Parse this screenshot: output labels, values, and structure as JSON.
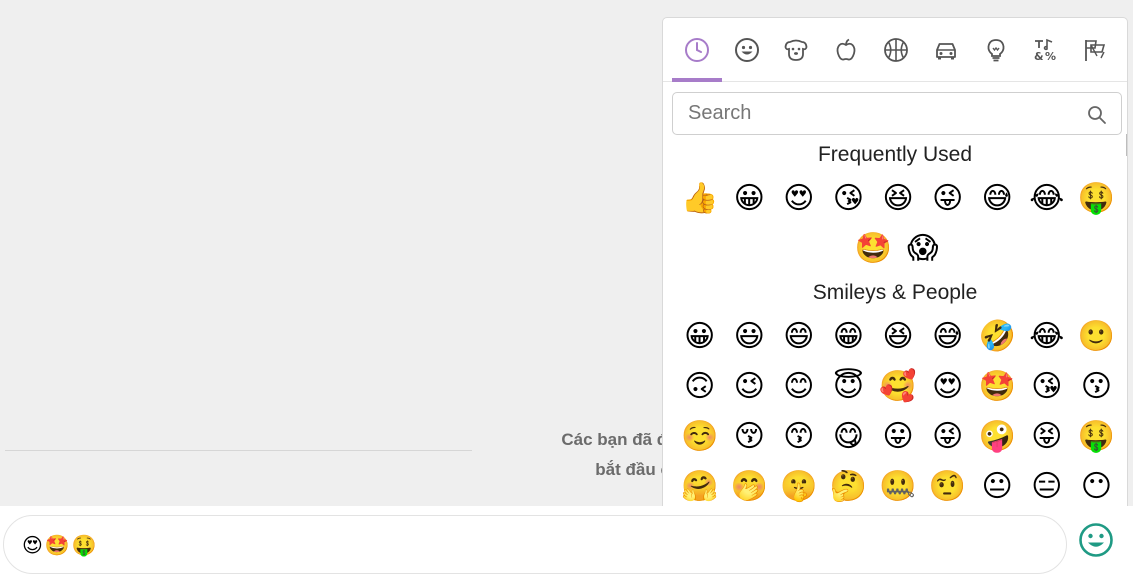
{
  "chat": {
    "system_message_line1": "Các bạn đã được kê",
    "system_message_line2": "bắt đầu cuộ"
  },
  "picker": {
    "tabs": [
      {
        "name": "tab-recent",
        "icon": "clock-icon"
      },
      {
        "name": "tab-smileys",
        "icon": "smiley-icon"
      },
      {
        "name": "tab-animals",
        "icon": "dog-icon"
      },
      {
        "name": "tab-food",
        "icon": "apple-icon"
      },
      {
        "name": "tab-activity",
        "icon": "basketball-icon"
      },
      {
        "name": "tab-travel",
        "icon": "car-icon"
      },
      {
        "name": "tab-objects",
        "icon": "lightbulb-icon"
      },
      {
        "name": "tab-symbols",
        "icon": "symbols-icon"
      },
      {
        "name": "tab-flags",
        "icon": "flags-icon"
      }
    ],
    "accent_color": "#a77cc9",
    "search_placeholder": "Search",
    "frequently_used_title": "Frequently Used",
    "frequently_used": [
      "👍",
      "😀",
      "😍",
      "😘",
      "😆",
      "😜",
      "😅",
      "😂",
      "🤑",
      "🤩",
      "😱"
    ],
    "smileys_title": "Smileys & People",
    "smileys": [
      "😀",
      "😃",
      "😄",
      "😁",
      "😆",
      "😅",
      "🤣",
      "😂",
      "🙂",
      "🙃",
      "😉",
      "😊",
      "😇",
      "🥰",
      "😍",
      "🤩",
      "😘",
      "😗",
      "☺️",
      "😚",
      "😙",
      "😋",
      "😛",
      "😜",
      "🤪",
      "😝",
      "🤑",
      "🤗",
      "🤭",
      "🤫",
      "🤔",
      "🤐",
      "🤨",
      "😐",
      "😑",
      "😶"
    ]
  },
  "composer": {
    "input_emojis": [
      "😍",
      "🤩",
      "🤑"
    ],
    "emoji_button_color": "#1f9a84"
  }
}
